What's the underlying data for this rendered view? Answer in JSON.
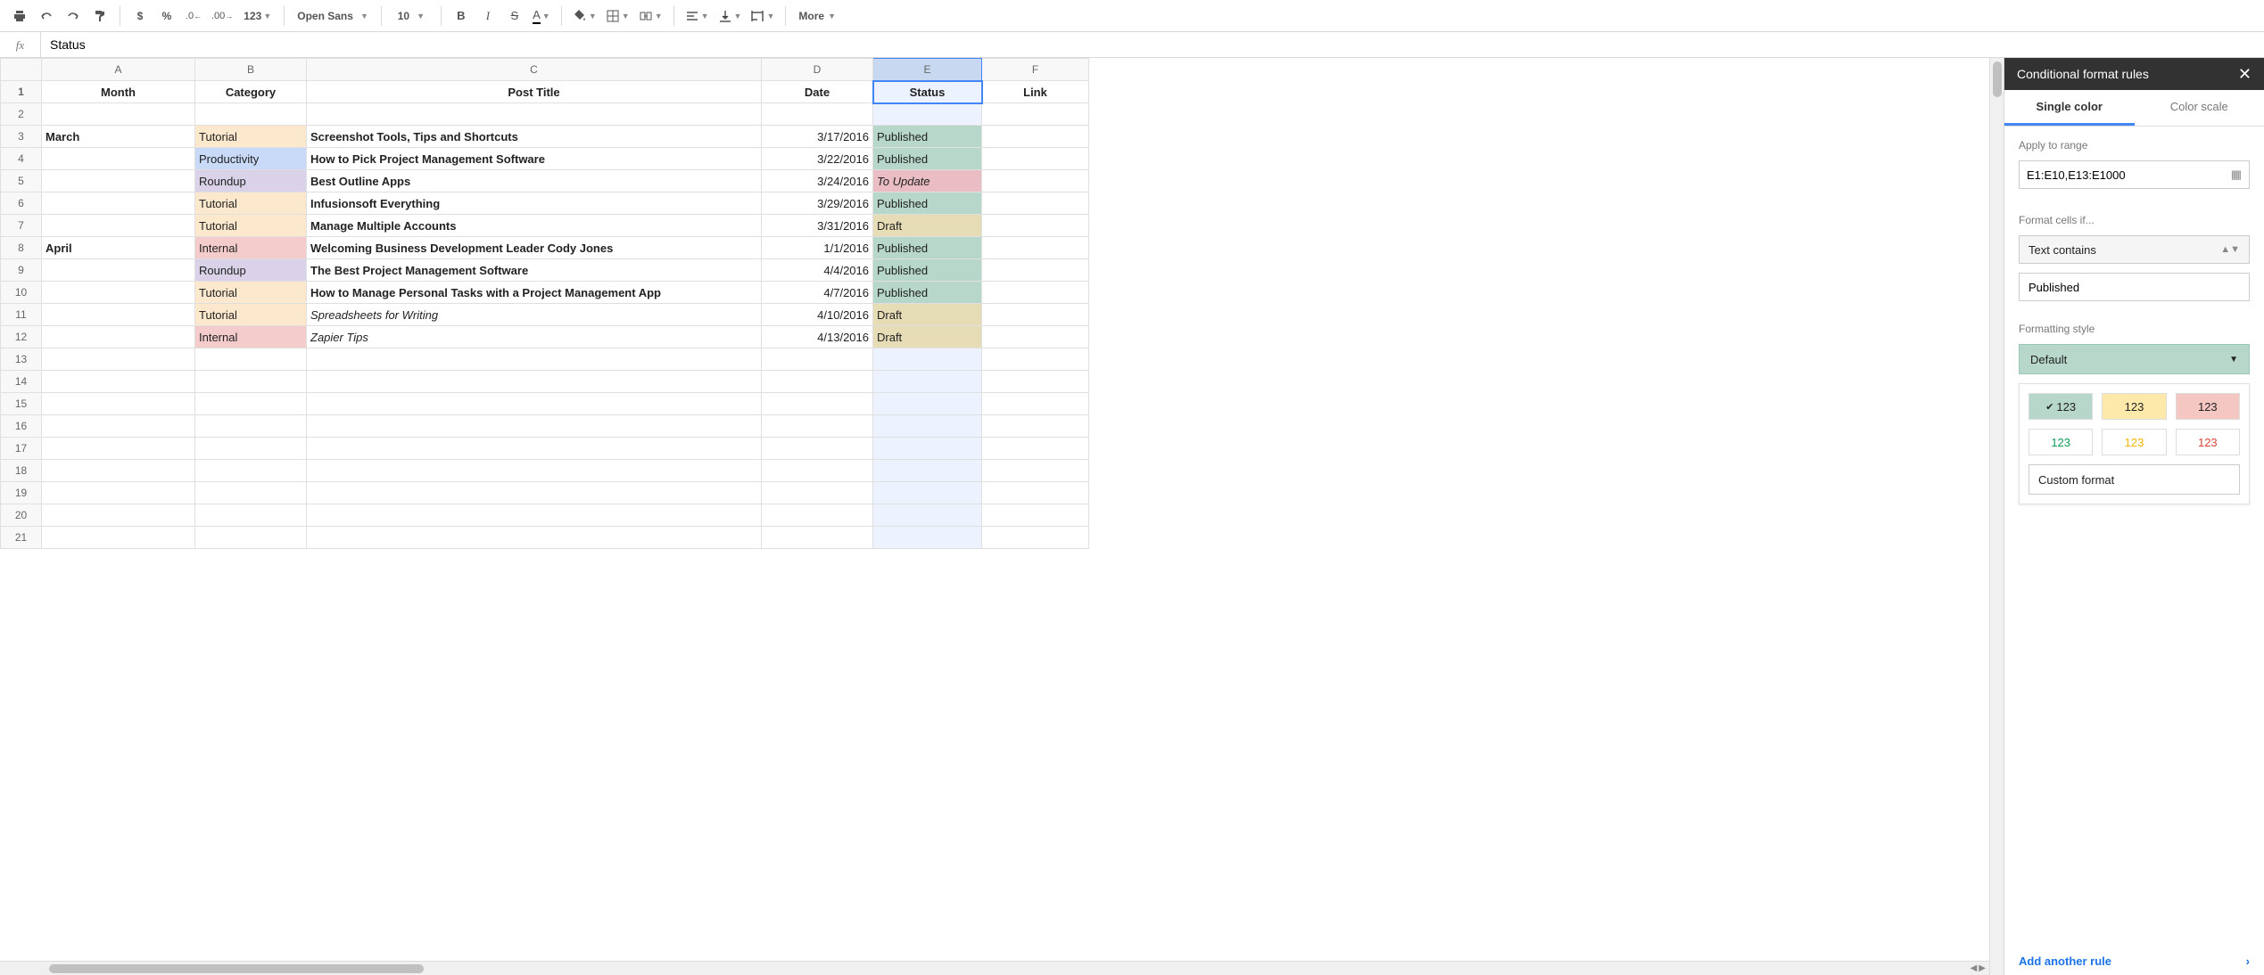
{
  "toolbar": {
    "currency": "$",
    "percent": "%",
    "dec_dec": ".0←",
    "dec_inc": ".00→",
    "num123": "123",
    "font": "Open Sans",
    "size": "10",
    "bold": "B",
    "italic": "I",
    "strike": "S",
    "color": "A",
    "more": "More"
  },
  "formula": {
    "fx": "fx",
    "value": "Status"
  },
  "columns": [
    "A",
    "B",
    "C",
    "D",
    "E",
    "F"
  ],
  "header_row": {
    "A": "Month",
    "B": "Category",
    "C": "Post Title",
    "D": "Date",
    "E": "Status",
    "F": "Link"
  },
  "rows": [
    {
      "n": 1
    },
    {
      "n": 2
    },
    {
      "n": 3,
      "A": "March",
      "B": "Tutorial",
      "Bc": "bg-tut",
      "C": "Screenshot Tools, Tips and Shortcuts",
      "Cb": true,
      "D": "3/17/2016",
      "E": "Published",
      "Ec": "bg-pub"
    },
    {
      "n": 4,
      "B": "Productivity",
      "Bc": "bg-prod",
      "C": "How to Pick Project Management Software",
      "Cb": true,
      "D": "3/22/2016",
      "E": "Published",
      "Ec": "bg-pub"
    },
    {
      "n": 5,
      "B": "Roundup",
      "Bc": "bg-round",
      "C": "Best Outline Apps",
      "Cb": true,
      "D": "3/24/2016",
      "E": "To Update",
      "Ec": "bg-upd"
    },
    {
      "n": 6,
      "B": "Tutorial",
      "Bc": "bg-tut",
      "C": "Infusionsoft Everything",
      "Cb": true,
      "D": "3/29/2016",
      "E": "Published",
      "Ec": "bg-pub"
    },
    {
      "n": 7,
      "B": "Tutorial",
      "Bc": "bg-tut",
      "C": "Manage Multiple Accounts",
      "Cb": true,
      "D": "3/31/2016",
      "E": "Draft",
      "Ec": "bg-draft"
    },
    {
      "n": 8,
      "A": "April",
      "B": "Internal",
      "Bc": "bg-int",
      "C": "Welcoming Business Development Leader Cody Jones",
      "Cb": true,
      "D": "1/1/2016",
      "E": "Published",
      "Ec": "bg-pub"
    },
    {
      "n": 9,
      "B": "Roundup",
      "Bc": "bg-round",
      "C": "The Best Project Management Software",
      "Cb": true,
      "D": "4/4/2016",
      "E": "Published",
      "Ec": "bg-pub"
    },
    {
      "n": 10,
      "B": "Tutorial",
      "Bc": "bg-tut",
      "C": "How to Manage Personal Tasks with a Project Management App",
      "Cb": true,
      "D": "4/7/2016",
      "E": "Published",
      "Ec": "bg-pub"
    },
    {
      "n": 11,
      "B": "Tutorial",
      "Bc": "bg-tut",
      "C": "Spreadsheets for Writing",
      "Ci": true,
      "D": "4/10/2016",
      "E": "Draft",
      "Ec": "bg-draft"
    },
    {
      "n": 12,
      "B": "Internal",
      "Bc": "bg-int",
      "C": "Zapier Tips",
      "Ci": true,
      "D": "4/13/2016",
      "E": "Draft",
      "Ec": "bg-draft"
    },
    {
      "n": 13
    },
    {
      "n": 14
    },
    {
      "n": 15
    },
    {
      "n": 16
    },
    {
      "n": 17
    },
    {
      "n": 18
    },
    {
      "n": 19
    },
    {
      "n": 20
    },
    {
      "n": 21
    }
  ],
  "panel": {
    "title": "Conditional format rules",
    "tab1": "Single color",
    "tab2": "Color scale",
    "apply_label": "Apply to range",
    "range": "E1:E10,E13:E1000",
    "cond_label": "Format cells if...",
    "cond_value": "Text contains",
    "cond_text": "Published",
    "style_label": "Formatting style",
    "default": "Default",
    "s1": "123",
    "s2": "123",
    "s3": "123",
    "s4": "123",
    "s5": "123",
    "s6": "123",
    "check": "✔",
    "custom": "Custom format",
    "add": "Add another rule"
  }
}
